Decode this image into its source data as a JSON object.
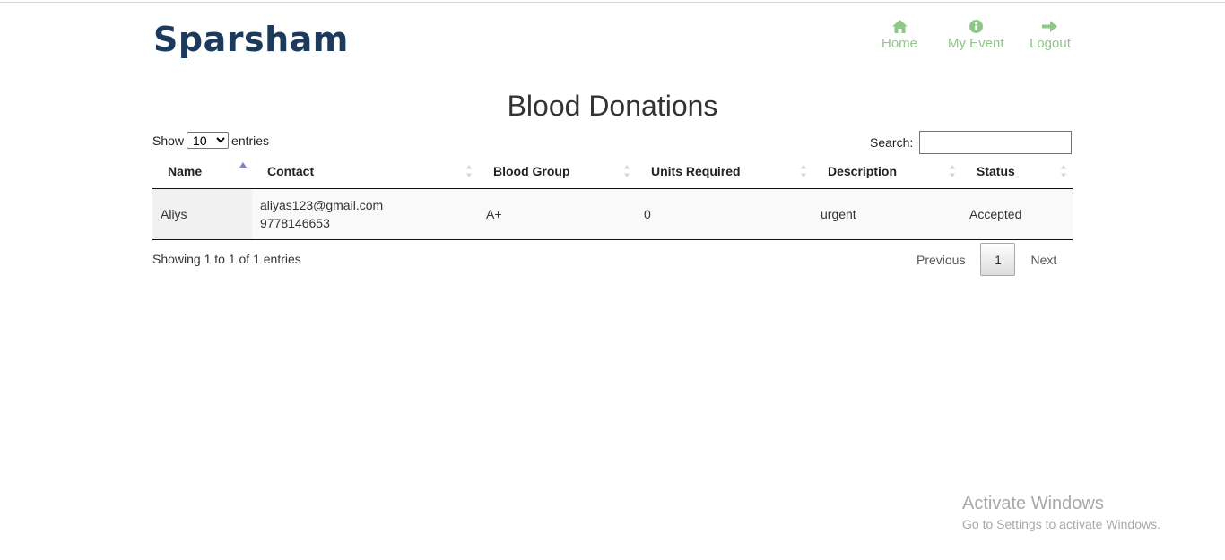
{
  "brand": {
    "logo": "Sparsham"
  },
  "nav": {
    "items": [
      {
        "label": "Home",
        "icon": "home-icon"
      },
      {
        "label": "My Event",
        "icon": "info-circle-icon"
      },
      {
        "label": "Logout",
        "icon": "arrow-right-icon"
      }
    ]
  },
  "page": {
    "title": "Blood Donations"
  },
  "table_controls": {
    "show_label": "Show",
    "entries_label": "entries",
    "page_length": "10",
    "search_label": "Search:",
    "search_value": ""
  },
  "table": {
    "columns": [
      "Name",
      "Contact",
      "Blood Group",
      "Units Required",
      "Description",
      "Status"
    ],
    "sorted_column": "Name",
    "rows": [
      {
        "name": "Aliys",
        "email": "aliyas123@gmail.com",
        "phone": "9778146653",
        "blood_group": "A+",
        "units_required": "0",
        "description": "urgent",
        "status": "Accepted"
      }
    ]
  },
  "footer": {
    "info": "Showing 1 to 1 of 1 entries",
    "previous_label": "Previous",
    "current_page": "1",
    "next_label": "Next"
  },
  "watermark": {
    "line1": "Activate Windows",
    "line2": "Go to Settings to activate Windows."
  },
  "colors": {
    "brand": "#1b3a5c",
    "nav": "#8fc78a",
    "sort_active": "#7b86c9"
  }
}
